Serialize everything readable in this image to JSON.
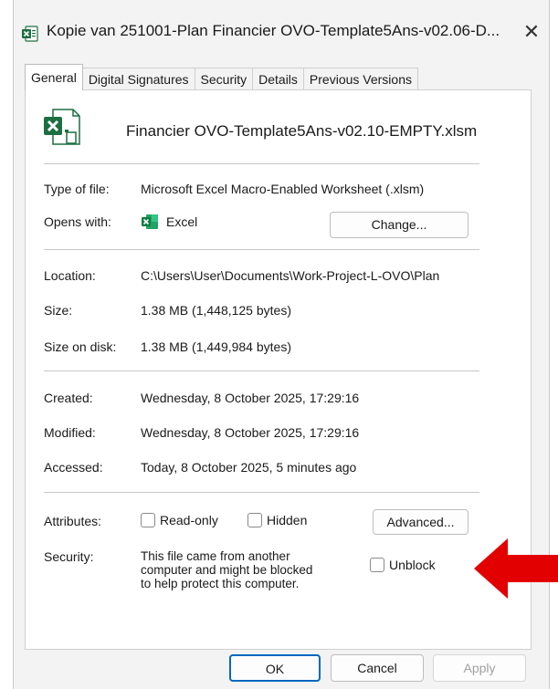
{
  "window": {
    "title": "Kopie van 251001-Plan Financier OVO-Template5Ans-v02.06-D...",
    "close_glyph": "✕"
  },
  "tabs": [
    {
      "label": "General",
      "active": true
    },
    {
      "label": "Digital Signatures",
      "active": false
    },
    {
      "label": "Security",
      "active": false
    },
    {
      "label": "Details",
      "active": false
    },
    {
      "label": "Previous Versions",
      "active": false
    }
  ],
  "general": {
    "file_name": "Financier OVO-Template5Ans-v02.10-EMPTY.xlsm",
    "type_label": "Type of file:",
    "type_value": "Microsoft Excel Macro-Enabled Worksheet (.xlsm)",
    "opens_label": "Opens with:",
    "opens_value": "Excel",
    "change_button": "Change...",
    "location_label": "Location:",
    "location_value": "C:\\Users\\User\\Documents\\Work-Project-L-OVO\\Plan",
    "size_label": "Size:",
    "size_value": "1.38 MB (1,448,125 bytes)",
    "size_disk_label": "Size on disk:",
    "size_disk_value": "1.38 MB (1,449,984 bytes)",
    "created_label": "Created:",
    "created_value": "Wednesday, 8 October 2025, 17:29:16",
    "modified_label": "Modified:",
    "modified_value": "Wednesday, 8 October 2025, 17:29:16",
    "accessed_label": "Accessed:",
    "accessed_value": "Today, 8 October 2025, 5 minutes ago",
    "attributes_label": "Attributes:",
    "readonly_label": "Read-only",
    "hidden_label": "Hidden",
    "advanced_button": "Advanced...",
    "security_label": "Security:",
    "security_text": "This file came from another computer and might be blocked to help protect this computer.",
    "unblock_label": "Unblock"
  },
  "footer": {
    "ok": "OK",
    "cancel": "Cancel",
    "apply": "Apply"
  },
  "colors": {
    "excel_green": "#1d6f42",
    "arrow_red": "#e30000",
    "ok_border": "#0067c0",
    "disabled_text": "#a0a0a0"
  },
  "icons": [
    "excel-small-icon",
    "excel-file-icon",
    "excel-app-icon",
    "close-icon",
    "red-arrow-icon"
  ]
}
